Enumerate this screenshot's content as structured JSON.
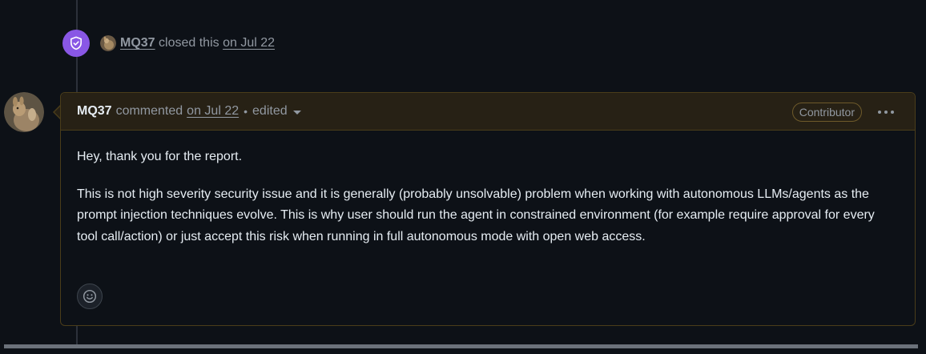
{
  "event": {
    "author": "MQ37",
    "action": "closed this",
    "date": "on Jul 22",
    "badge_icon": "shield-check-icon",
    "badge_color": "#8957e5"
  },
  "comment": {
    "author": "MQ37",
    "action": "commented",
    "date": "on Jul 22",
    "separator": "•",
    "edited_label": "edited",
    "role_badge": "Contributor",
    "paragraphs": [
      "Hey, thank you for the report.",
      "This is not high severity security issue and it is generally (probably unsolvable) problem when working with autonomous LLMs/agents as the prompt injection techniques evolve. This is why user should run the agent in constrained environment (for example require approval for every tool call/action) or just accept this risk when running in full autonomous mode with open web access."
    ],
    "reaction_icon": "smiley-icon",
    "more_icon": "kebab-horizontal-icon"
  },
  "colors": {
    "background": "#0d1117",
    "header_bg": "#272115",
    "border": "#4a3d1a",
    "muted_text": "#9198a1",
    "primary_text": "#e6edf3"
  }
}
